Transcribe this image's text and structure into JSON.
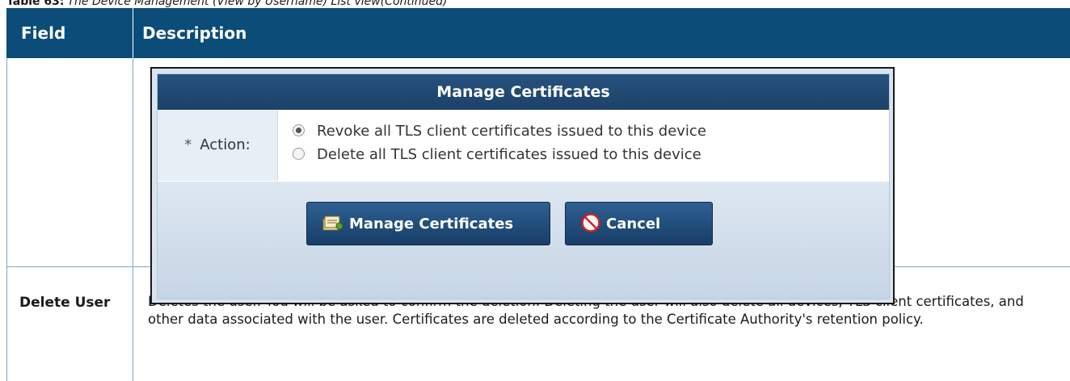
{
  "caption": {
    "table_label": "Table 63:",
    "table_title": "The Device Management (View by Username) List view(Continued)"
  },
  "table": {
    "headers": {
      "field": "Field",
      "description": "Description"
    },
    "rows": [
      {
        "field": "",
        "dialog": {
          "title": "Manage Certificates",
          "action_label": "Action:",
          "required_marker": "*",
          "options": [
            {
              "label": "Revoke all TLS client certificates issued to this device",
              "selected": true
            },
            {
              "label": "Delete all TLS client certificates issued to this device",
              "selected": false
            }
          ],
          "buttons": {
            "manage": "Manage Certificates",
            "cancel": "Cancel"
          }
        }
      },
      {
        "field": "Delete User",
        "description": "Deletes the user. You will be asked to confirm the deletion. Deleting the user will also delete all devices, TLS client certificates, and other data associated with the user. Certificates are deleted according to the Certificate Authority's retention policy."
      }
    ]
  },
  "colors": {
    "header_bg": "#0b4c78",
    "dialog_title_bg": "#1c4168",
    "button_bg": "#173e67",
    "grid_line": "#7ea8c4"
  },
  "icons": {
    "manage_button_icon": "certificate-stack-icon",
    "cancel_button_icon": "no-entry-icon"
  }
}
